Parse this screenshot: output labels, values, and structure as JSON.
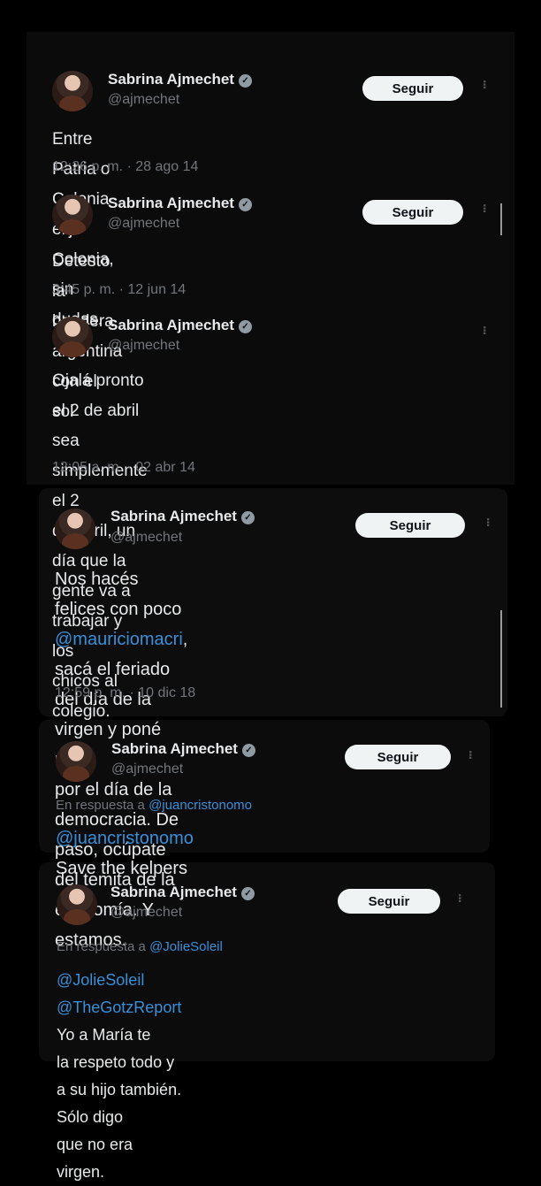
{
  "tweets": [
    {
      "name": "Sabrina Ajmechet",
      "handle": "@ajmechet",
      "follow_label": "Seguir",
      "text": "Entre Patria o Colonia elijo Colonia, sin dudas.",
      "timestamp": "12:26 p. m. · 28 ago 14"
    },
    {
      "name": "Sabrina Ajmechet",
      "handle": "@ajmechet",
      "follow_label": "Seguir",
      "text": "Detesto la bandera argentina con el sol",
      "timestamp": "3:45 p. m. · 12 jun 14"
    },
    {
      "name": "Sabrina Ajmechet",
      "handle": "@ajmechet",
      "text_lines": [
        "Ojalá pronto el 2 de abril sea simplemente el 2",
        "de abril, un día que la gente va a trabajar y los",
        "chicos al colegio."
      ],
      "timestamp": "12:05 a. m. · 02 abr 14"
    },
    {
      "name": "Sabrina Ajmechet",
      "handle": "@ajmechet",
      "follow_label": "Seguir",
      "text_line1_prefix": "Nos hacés felices con poco ",
      "text_line1_mention": "@mauriciomacri",
      "text_line1_suffix": ",",
      "text_lines_rest": [
        "sacá el feriado del día de la virgen y poné uno",
        "por el día de la democracia. De paso, ocúpate",
        "del temita de la economía. Y estamos."
      ],
      "timestamp": "12:59 p. m. · 10 dic 18"
    },
    {
      "name": "Sabrina Ajmechet",
      "handle": "@ajmechet",
      "follow_label": "Seguir",
      "reply_prefix": "En respuesta a ",
      "reply_to": "@juancristonomo",
      "text_mention": "@juancristonomo",
      "text_rest": " Save the kelpers"
    },
    {
      "name": "Sabrina Ajmechet",
      "handle": "@ajmechet",
      "follow_label": "Seguir",
      "reply_prefix": "En respuesta a ",
      "reply_to": "@JolieSoleil",
      "text_mention1": "@JolieSoleil",
      "text_space": " ",
      "text_mention2": "@TheGotzReport",
      "text_line1_rest": " Yo a María te",
      "text_lines_rest": [
        "la respeto todo y a su hijo también. Sólo digo",
        "que no era virgen."
      ]
    }
  ],
  "icons": {
    "verified": "verified-badge-icon",
    "more": "more-options-icon"
  },
  "colors": {
    "background": "#000000",
    "text": "#e7e9ea",
    "secondary": "#71767b",
    "mention": "#3a8fd9",
    "button_bg": "#eff3f4"
  }
}
